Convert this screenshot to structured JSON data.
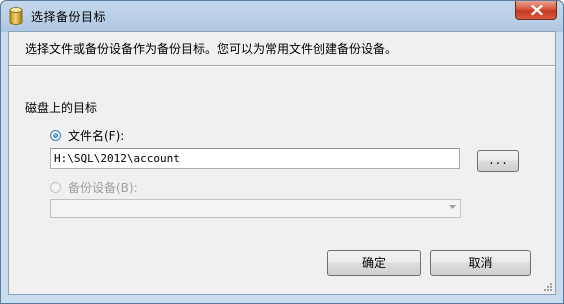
{
  "window": {
    "title": "选择备份目标"
  },
  "dialog": {
    "instruction": "选择文件或备份设备作为备份目标。您可以为常用文件创建备份设备。",
    "section_title": "磁盘上的目标",
    "file_option": {
      "label": "文件名(F):",
      "checked": true,
      "value": "H:\\SQL\\2012\\account"
    },
    "browse_label": "...",
    "device_option": {
      "label": "备份设备(B):",
      "checked": false,
      "enabled": false,
      "selected": ""
    },
    "ok_label": "确定",
    "cancel_label": "取消"
  },
  "colors": {
    "title_bar": "#c4d8ec",
    "client_bg": "#f0f0f0",
    "close_red": "#c6391f",
    "disabled_text": "#a0a0a0"
  },
  "icons": {
    "app": "database-cylinder-icon",
    "close": "close-icon",
    "dropdown": "chevron-down-icon"
  }
}
